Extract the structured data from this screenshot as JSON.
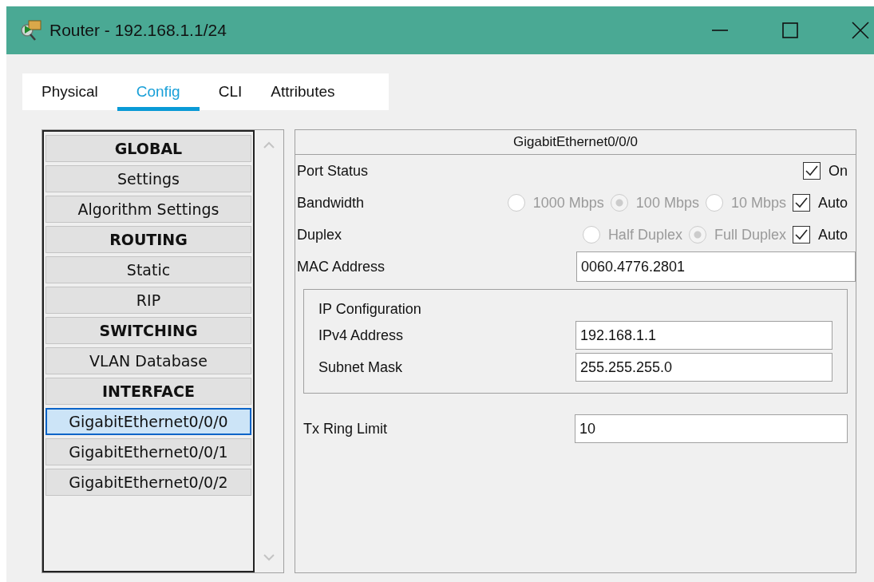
{
  "window": {
    "title": "Router - 192.168.1.1/24"
  },
  "tabs": [
    {
      "label": "Physical",
      "selected": false
    },
    {
      "label": "Config",
      "selected": true
    },
    {
      "label": "CLI",
      "selected": false
    },
    {
      "label": "Attributes",
      "selected": false
    }
  ],
  "sidebar": {
    "items": [
      {
        "label": "GLOBAL",
        "kind": "header",
        "selected": false
      },
      {
        "label": "Settings",
        "kind": "item",
        "selected": false
      },
      {
        "label": "Algorithm Settings",
        "kind": "item",
        "selected": false
      },
      {
        "label": "ROUTING",
        "kind": "header",
        "selected": false
      },
      {
        "label": "Static",
        "kind": "item",
        "selected": false
      },
      {
        "label": "RIP",
        "kind": "item",
        "selected": false
      },
      {
        "label": "SWITCHING",
        "kind": "header",
        "selected": false
      },
      {
        "label": "VLAN Database",
        "kind": "item",
        "selected": false
      },
      {
        "label": "INTERFACE",
        "kind": "header",
        "selected": false
      },
      {
        "label": "GigabitEthernet0/0/0",
        "kind": "item",
        "selected": true
      },
      {
        "label": "GigabitEthernet0/0/1",
        "kind": "item",
        "selected": false
      },
      {
        "label": "GigabitEthernet0/0/2",
        "kind": "item",
        "selected": false
      }
    ]
  },
  "panel": {
    "title": "GigabitEthernet0/0/0",
    "port_status": {
      "label": "Port Status",
      "checked": true,
      "option": "On"
    },
    "bandwidth": {
      "label": "Bandwidth",
      "disabled": true,
      "options": [
        {
          "label": "1000 Mbps",
          "selected": false
        },
        {
          "label": "100 Mbps",
          "selected": true
        },
        {
          "label": "10 Mbps",
          "selected": false
        }
      ],
      "auto": {
        "label": "Auto",
        "checked": true
      }
    },
    "duplex": {
      "label": "Duplex",
      "disabled": true,
      "options": [
        {
          "label": "Half Duplex",
          "selected": false
        },
        {
          "label": "Full Duplex",
          "selected": true
        }
      ],
      "auto": {
        "label": "Auto",
        "checked": true
      }
    },
    "mac_address": {
      "label": "MAC Address",
      "value": "0060.4776.2801"
    },
    "ip_configuration": {
      "title": "IP Configuration",
      "fields": [
        {
          "label": "IPv4 Address",
          "value": "192.168.1.1"
        },
        {
          "label": "Subnet Mask",
          "value": "255.255.255.0"
        }
      ]
    },
    "tx_ring_limit": {
      "label": "Tx Ring Limit",
      "value": "10"
    }
  }
}
